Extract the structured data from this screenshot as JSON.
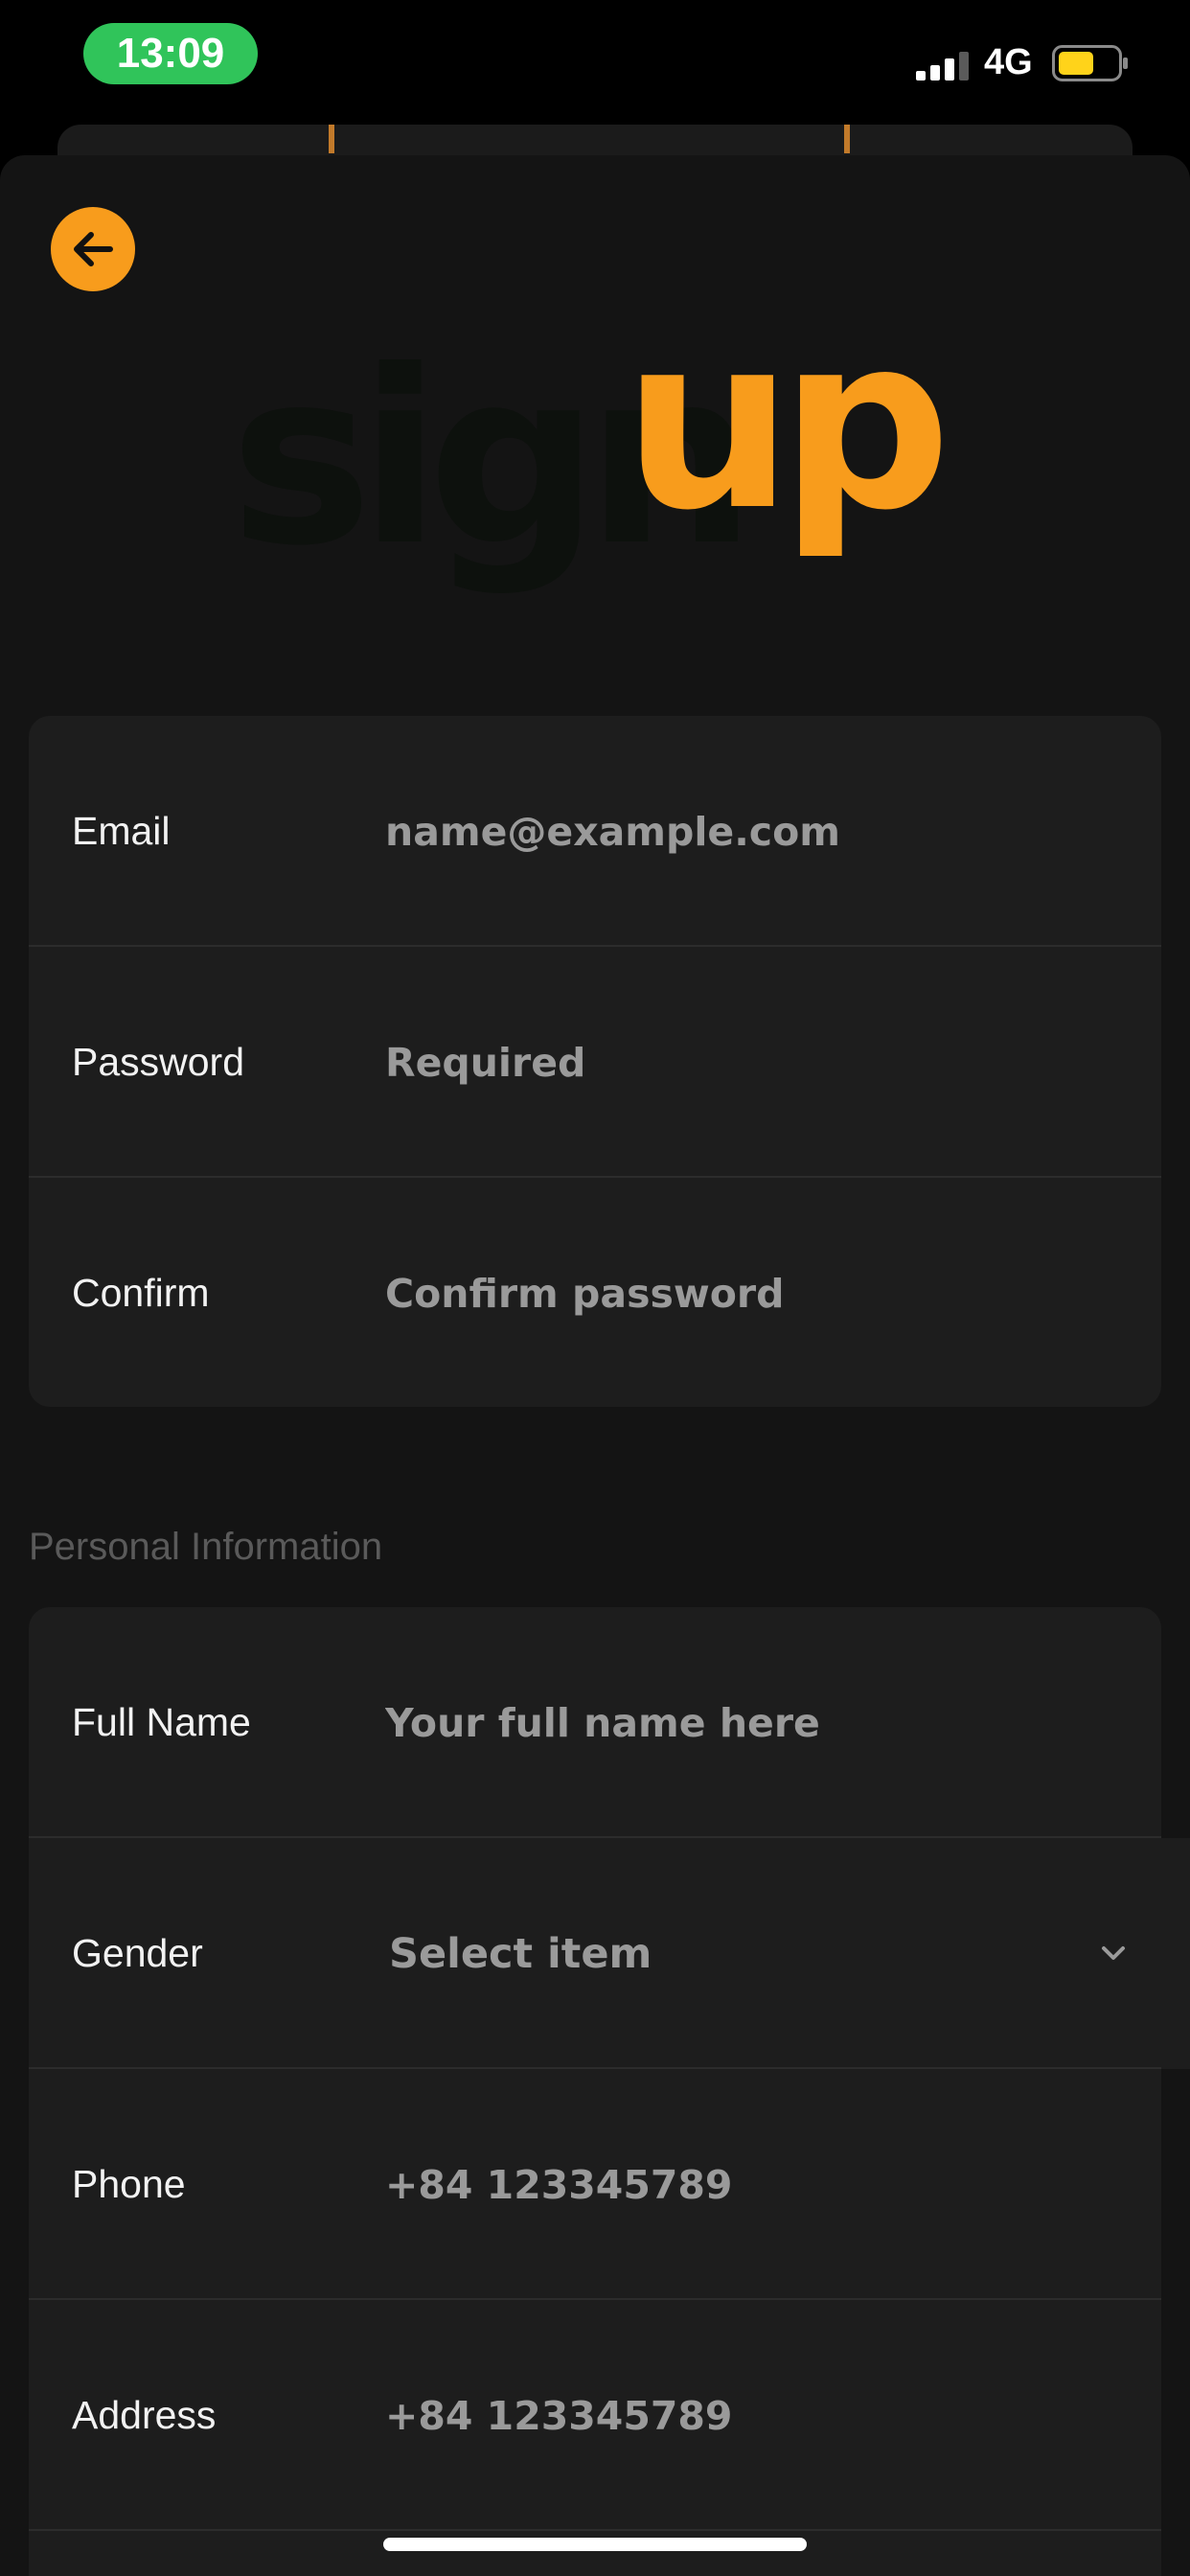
{
  "status": {
    "time": "13:09",
    "network": "4G",
    "colors": {
      "pill": "#30c45a",
      "battery_fill": "#ffd31a"
    }
  },
  "header": {
    "back_icon": "arrow-left-icon",
    "logo_text_dark": "sign",
    "logo_text_accent": "up",
    "accent_color": "#f89c1c"
  },
  "account": {
    "fields": [
      {
        "label": "Email",
        "placeholder": "name@example.com",
        "value": ""
      },
      {
        "label": "Password",
        "placeholder": "Required",
        "value": ""
      },
      {
        "label": "Confirm",
        "placeholder": "Confirm password",
        "value": ""
      }
    ]
  },
  "personal": {
    "section_title": "Personal Information",
    "full_name": {
      "label": "Full Name",
      "placeholder": "Your full name here",
      "value": ""
    },
    "gender": {
      "label": "Gender",
      "selected": "Select item",
      "icon": "chevron-down-icon"
    },
    "phone": {
      "label": "Phone",
      "placeholder": "+84 123345789",
      "value": ""
    },
    "address": {
      "label": "Address",
      "placeholder": "+84 123345789",
      "value": ""
    }
  }
}
